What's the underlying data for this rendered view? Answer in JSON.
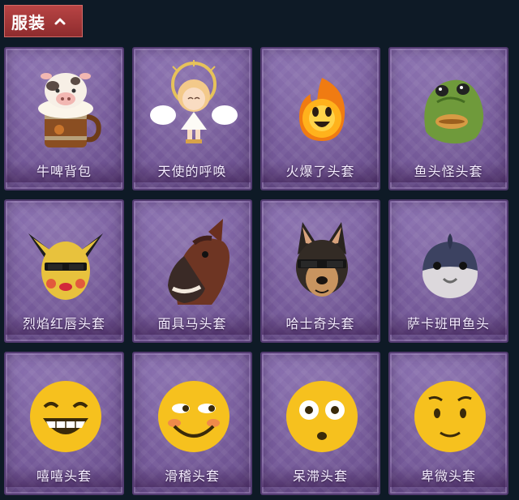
{
  "header": {
    "title": "服装",
    "toggle_icon": "chevron-up-icon"
  },
  "colors": {
    "background": "#0e1a26",
    "header_bg": "#9c3436",
    "card_bg": "#7a5f9f"
  },
  "items": [
    {
      "label": "牛啤背包",
      "icon": "cow-beer-backpack"
    },
    {
      "label": "天使的呼唤",
      "icon": "angel-doll"
    },
    {
      "label": "火爆了头套",
      "icon": "fire-sprite-head"
    },
    {
      "label": "鱼头怪头套",
      "icon": "fish-monster-head"
    },
    {
      "label": "烈焰红唇头套",
      "icon": "yellow-mouse-head"
    },
    {
      "label": "面具马头套",
      "icon": "horse-mask-head"
    },
    {
      "label": "哈士奇头套",
      "icon": "husky-head"
    },
    {
      "label": "萨卡班甲鱼头",
      "icon": "sacabambaspis-head"
    },
    {
      "label": "嘻嘻头套",
      "icon": "grinning-emoji-head"
    },
    {
      "label": "滑稽头套",
      "icon": "funny-emoji-head"
    },
    {
      "label": "呆滞头套",
      "icon": "stunned-emoji-head"
    },
    {
      "label": "卑微头套",
      "icon": "humble-emoji-head"
    }
  ]
}
